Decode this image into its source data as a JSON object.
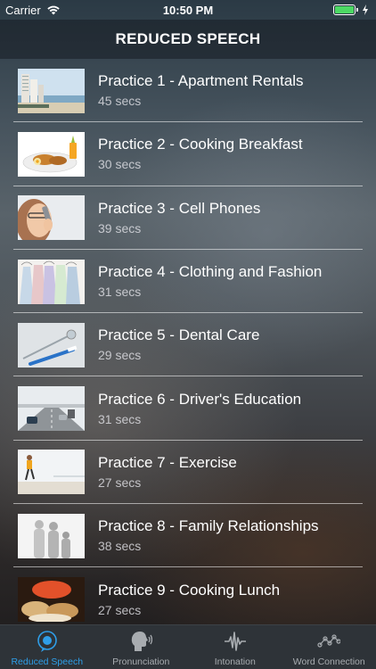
{
  "status": {
    "carrier": "Carrier",
    "time": "10:50 PM"
  },
  "nav": {
    "title": "REDUCED SPEECH"
  },
  "practices": [
    {
      "title": "Practice 1 - Apartment Rentals",
      "duration": "45 secs",
      "icon": "beach-apartment-image"
    },
    {
      "title": "Practice 2 - Cooking Breakfast",
      "duration": "30 secs",
      "icon": "breakfast-plate-image"
    },
    {
      "title": "Practice 3 - Cell Phones",
      "duration": "39 secs",
      "icon": "woman-on-phone-image"
    },
    {
      "title": "Practice 4 - Clothing and Fashion",
      "duration": "31 secs",
      "icon": "clothes-on-hangers-image"
    },
    {
      "title": "Practice 5 - Dental Care",
      "duration": "29 secs",
      "icon": "dental-tools-image"
    },
    {
      "title": "Practice 6 - Driver's Education",
      "duration": "31 secs",
      "icon": "highway-traffic-image"
    },
    {
      "title": "Practice 7 - Exercise",
      "duration": "27 secs",
      "icon": "runner-on-beach-image"
    },
    {
      "title": "Practice 8 - Family Relationships",
      "duration": "38 secs",
      "icon": "family-silhouette-image"
    },
    {
      "title": "Practice 9 - Cooking Lunch",
      "duration": "27 secs",
      "icon": "bread-loaves-image"
    }
  ],
  "tabs": [
    {
      "label": "Reduced Speech",
      "icon": "speech-bubble-icon",
      "active": true
    },
    {
      "label": "Pronunciation",
      "icon": "speaking-head-icon",
      "active": false
    },
    {
      "label": "Intonation",
      "icon": "waveform-icon",
      "active": false
    },
    {
      "label": "Word Connection",
      "icon": "connected-dots-icon",
      "active": false
    }
  ],
  "colors": {
    "accent": "#2f9ee8",
    "battery": "#4cd964",
    "tab_inactive": "#a8acb0"
  }
}
